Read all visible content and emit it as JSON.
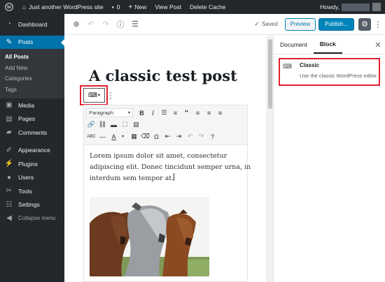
{
  "admin_bar": {
    "site_name": "Just another WordPress site",
    "comments_count": "0",
    "new_label": "New",
    "view_post": "View Post",
    "delete_cache": "Delete Cache",
    "howdy": "Howdy,"
  },
  "sidebar": {
    "items": [
      {
        "label": "Dashboard",
        "icon": "dashboard-icon"
      },
      {
        "label": "Posts",
        "icon": "pin-icon"
      },
      {
        "label": "Media",
        "icon": "media-icon"
      },
      {
        "label": "Pages",
        "icon": "pages-icon"
      },
      {
        "label": "Comments",
        "icon": "comments-icon"
      },
      {
        "label": "Appearance",
        "icon": "brush-icon"
      },
      {
        "label": "Plugins",
        "icon": "plugin-icon"
      },
      {
        "label": "Users",
        "icon": "users-icon"
      },
      {
        "label": "Tools",
        "icon": "wrench-icon"
      },
      {
        "label": "Settings",
        "icon": "settings-icon"
      }
    ],
    "posts_submenu": [
      "All Posts",
      "Add New",
      "Categories",
      "Tags"
    ],
    "collapse_label": "Collapse menu"
  },
  "header": {
    "saved_label": "Saved",
    "preview_label": "Preview",
    "publish_label": "Publish..."
  },
  "editor": {
    "post_title": "A classic test post",
    "format_select": "Paragraph",
    "paragraph": [
      "Lorem ipsum dolor sit amet, consectetur",
      "adipiscing elit. Donec tincidunt semper urna, in",
      "interdum sem tempor at."
    ],
    "image_subject": "three horses"
  },
  "settings_panel": {
    "tabs": [
      "Document",
      "Block"
    ],
    "active_tab": "Block",
    "block_name": "Classic",
    "block_description": "Use the classic WordPress editor."
  },
  "colors": {
    "admin_dark": "#23282d",
    "accent_blue": "#0085ba",
    "highlight_red": "#e2202f"
  }
}
